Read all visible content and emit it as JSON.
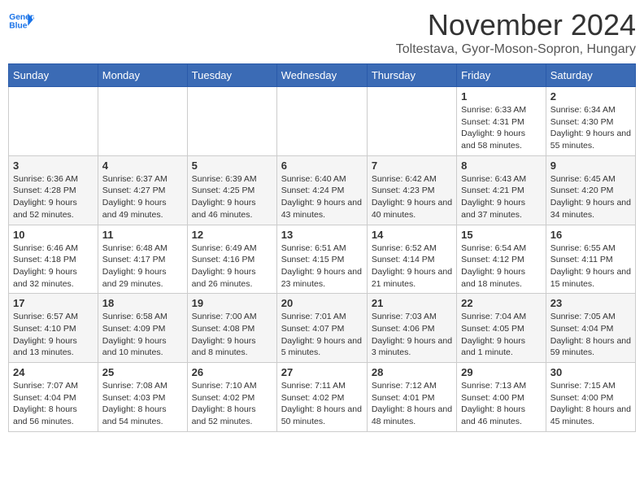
{
  "header": {
    "logo_line1": "General",
    "logo_line2": "Blue",
    "month_title": "November 2024",
    "location": "Toltestava, Gyor-Moson-Sopron, Hungary"
  },
  "days_of_week": [
    "Sunday",
    "Monday",
    "Tuesday",
    "Wednesday",
    "Thursday",
    "Friday",
    "Saturday"
  ],
  "weeks": [
    [
      {
        "day": "",
        "info": ""
      },
      {
        "day": "",
        "info": ""
      },
      {
        "day": "",
        "info": ""
      },
      {
        "day": "",
        "info": ""
      },
      {
        "day": "",
        "info": ""
      },
      {
        "day": "1",
        "info": "Sunrise: 6:33 AM\nSunset: 4:31 PM\nDaylight: 9 hours and 58 minutes."
      },
      {
        "day": "2",
        "info": "Sunrise: 6:34 AM\nSunset: 4:30 PM\nDaylight: 9 hours and 55 minutes."
      }
    ],
    [
      {
        "day": "3",
        "info": "Sunrise: 6:36 AM\nSunset: 4:28 PM\nDaylight: 9 hours and 52 minutes."
      },
      {
        "day": "4",
        "info": "Sunrise: 6:37 AM\nSunset: 4:27 PM\nDaylight: 9 hours and 49 minutes."
      },
      {
        "day": "5",
        "info": "Sunrise: 6:39 AM\nSunset: 4:25 PM\nDaylight: 9 hours and 46 minutes."
      },
      {
        "day": "6",
        "info": "Sunrise: 6:40 AM\nSunset: 4:24 PM\nDaylight: 9 hours and 43 minutes."
      },
      {
        "day": "7",
        "info": "Sunrise: 6:42 AM\nSunset: 4:23 PM\nDaylight: 9 hours and 40 minutes."
      },
      {
        "day": "8",
        "info": "Sunrise: 6:43 AM\nSunset: 4:21 PM\nDaylight: 9 hours and 37 minutes."
      },
      {
        "day": "9",
        "info": "Sunrise: 6:45 AM\nSunset: 4:20 PM\nDaylight: 9 hours and 34 minutes."
      }
    ],
    [
      {
        "day": "10",
        "info": "Sunrise: 6:46 AM\nSunset: 4:18 PM\nDaylight: 9 hours and 32 minutes."
      },
      {
        "day": "11",
        "info": "Sunrise: 6:48 AM\nSunset: 4:17 PM\nDaylight: 9 hours and 29 minutes."
      },
      {
        "day": "12",
        "info": "Sunrise: 6:49 AM\nSunset: 4:16 PM\nDaylight: 9 hours and 26 minutes."
      },
      {
        "day": "13",
        "info": "Sunrise: 6:51 AM\nSunset: 4:15 PM\nDaylight: 9 hours and 23 minutes."
      },
      {
        "day": "14",
        "info": "Sunrise: 6:52 AM\nSunset: 4:14 PM\nDaylight: 9 hours and 21 minutes."
      },
      {
        "day": "15",
        "info": "Sunrise: 6:54 AM\nSunset: 4:12 PM\nDaylight: 9 hours and 18 minutes."
      },
      {
        "day": "16",
        "info": "Sunrise: 6:55 AM\nSunset: 4:11 PM\nDaylight: 9 hours and 15 minutes."
      }
    ],
    [
      {
        "day": "17",
        "info": "Sunrise: 6:57 AM\nSunset: 4:10 PM\nDaylight: 9 hours and 13 minutes."
      },
      {
        "day": "18",
        "info": "Sunrise: 6:58 AM\nSunset: 4:09 PM\nDaylight: 9 hours and 10 minutes."
      },
      {
        "day": "19",
        "info": "Sunrise: 7:00 AM\nSunset: 4:08 PM\nDaylight: 9 hours and 8 minutes."
      },
      {
        "day": "20",
        "info": "Sunrise: 7:01 AM\nSunset: 4:07 PM\nDaylight: 9 hours and 5 minutes."
      },
      {
        "day": "21",
        "info": "Sunrise: 7:03 AM\nSunset: 4:06 PM\nDaylight: 9 hours and 3 minutes."
      },
      {
        "day": "22",
        "info": "Sunrise: 7:04 AM\nSunset: 4:05 PM\nDaylight: 9 hours and 1 minute."
      },
      {
        "day": "23",
        "info": "Sunrise: 7:05 AM\nSunset: 4:04 PM\nDaylight: 8 hours and 59 minutes."
      }
    ],
    [
      {
        "day": "24",
        "info": "Sunrise: 7:07 AM\nSunset: 4:04 PM\nDaylight: 8 hours and 56 minutes."
      },
      {
        "day": "25",
        "info": "Sunrise: 7:08 AM\nSunset: 4:03 PM\nDaylight: 8 hours and 54 minutes."
      },
      {
        "day": "26",
        "info": "Sunrise: 7:10 AM\nSunset: 4:02 PM\nDaylight: 8 hours and 52 minutes."
      },
      {
        "day": "27",
        "info": "Sunrise: 7:11 AM\nSunset: 4:02 PM\nDaylight: 8 hours and 50 minutes."
      },
      {
        "day": "28",
        "info": "Sunrise: 7:12 AM\nSunset: 4:01 PM\nDaylight: 8 hours and 48 minutes."
      },
      {
        "day": "29",
        "info": "Sunrise: 7:13 AM\nSunset: 4:00 PM\nDaylight: 8 hours and 46 minutes."
      },
      {
        "day": "30",
        "info": "Sunrise: 7:15 AM\nSunset: 4:00 PM\nDaylight: 8 hours and 45 minutes."
      }
    ]
  ]
}
